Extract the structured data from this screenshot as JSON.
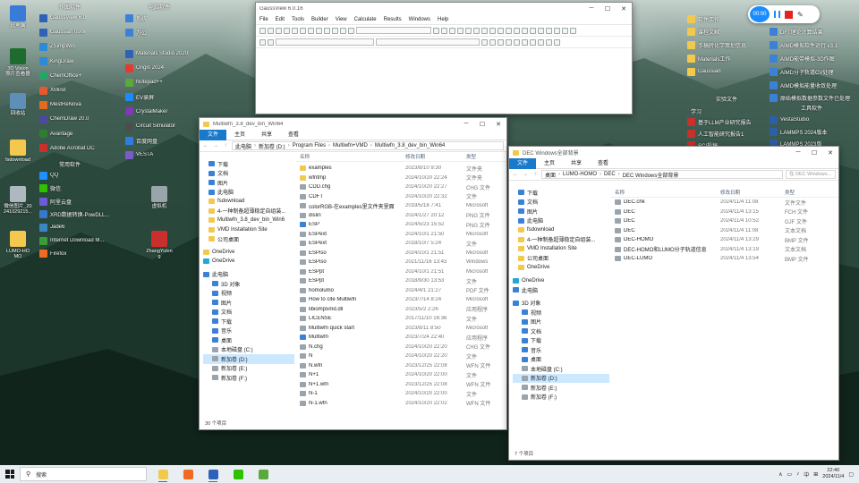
{
  "desktop": {
    "left_icons": [
      {
        "label": "此电脑",
        "color": "#3b7bd8"
      },
      {
        "label": "3D Vision\n照片查看器",
        "color": "#1d6b2e"
      },
      {
        "label": "回收站",
        "color": "#5f8fb7"
      },
      {
        "label": "fsdownload",
        "color": "#f3c94d"
      },
      {
        "label": "微信图片_20\n241029215...",
        "color": "#b0b8bf"
      },
      {
        "label": "LUMO-HO\nMO",
        "color": "#f3c94d"
      }
    ],
    "col2_header": "作图软件",
    "col2": [
      {
        "label": "GaussView 6.0",
        "color": "#2d62b8"
      },
      {
        "label": "Gaussian 09W",
        "color": "#2d62b8"
      },
      {
        "label": "ZSimpWin",
        "color": "#2a8bd6"
      },
      {
        "label": "KingDraw",
        "color": "#2a8bd6"
      },
      {
        "label": "ChemOffice+",
        "color": "#2aa36b"
      },
      {
        "label": "XMind",
        "color": "#e25a2e"
      },
      {
        "label": "MestReNova",
        "color": "#e66a22"
      },
      {
        "label": "ChemDraw 20.0",
        "color": "#4b4b9e"
      },
      {
        "label": "Avantage",
        "color": "#2f7d32"
      },
      {
        "label": "Adobe Acrobat DC",
        "color": "#c9302c"
      }
    ],
    "col2_header2": "常用软件",
    "col2b": [
      {
        "label": "QQ",
        "color": "#1e90ff"
      },
      {
        "label": "微信",
        "color": "#2dc100"
      },
      {
        "label": "阿里云盘",
        "color": "#6b5bd6"
      },
      {
        "label": "XRD数据转换-PowDLL...",
        "color": "#3778c9"
      },
      {
        "label": "Jade6",
        "color": "#3a87c5"
      },
      {
        "label": "Internet Download M...",
        "color": "#3a9d3a"
      },
      {
        "label": "Firefox",
        "color": "#f06b21"
      }
    ],
    "col3_header": "电脑软件",
    "col3": [
      {
        "label": "Materials Studio 2020",
        "color": "#2d62b8"
      },
      {
        "label": "Origin 2024",
        "color": "#e63a2e"
      },
      {
        "label": "Notepad++",
        "color": "#5aa93b"
      },
      {
        "label": "EV录屏",
        "color": "#1a8cff"
      },
      {
        "label": "CrystalMaker",
        "color": "#7e3bb5"
      },
      {
        "label": "Circuit Simulator",
        "color": "#4d4d4d"
      },
      {
        "label": "百度网盘",
        "color": "#2f7de1"
      },
      {
        "label": "VESTA",
        "color": "#7a5cc8"
      }
    ],
    "col3_extra": [
      {
        "label": "系统",
        "color": "#3b82d6"
      },
      {
        "label": "办公",
        "color": "#3b82d6"
      },
      {
        "label": "测绘软件",
        "color": "#3b82d6"
      },
      {
        "label": "设计",
        "color": "#3b82d6"
      },
      {
        "label": "文档",
        "color": "#3b82d6"
      },
      {
        "label": "磁盘",
        "color": "#3b82d6"
      },
      {
        "label": "软件",
        "color": "#3b82d6"
      },
      {
        "label": "个人收藏",
        "color": "#3b82d6"
      }
    ],
    "mid_icons": [
      {
        "label": "ZhangYulon\ng",
        "color": "#c9302c"
      },
      {
        "label": "虚拟机",
        "color": "#9aa4ad"
      }
    ],
    "right_header": "实验文件",
    "right_col_a": [
      {
        "label": "软件工作",
        "color": "#f3c94d"
      },
      {
        "label": "课程文献",
        "color": "#f3c94d"
      },
      {
        "label": "手稿转化学策划信息",
        "color": "#f3c94d"
      },
      {
        "label": "Materials工作",
        "color": "#f3c94d"
      },
      {
        "label": "Gaussian",
        "color": "#f3c94d"
      }
    ],
    "right_col_b": [
      {
        "label": "数据版本3.3",
        "color": "#3b82d6"
      },
      {
        "label": "DFT理论计算结果",
        "color": "#3b82d6"
      },
      {
        "label": "AIMD模拟软件运行 v3.1",
        "color": "#3b82d6"
      },
      {
        "label": "AIMD能带模拟-3D作图",
        "color": "#3b82d6"
      },
      {
        "label": "AIMD分子轨道CV处理",
        "color": "#3b82d6"
      },
      {
        "label": "AIMD模拟能量收敛处理",
        "color": "#3b82d6"
      },
      {
        "label": "原始模拟数据参数文件已处理",
        "color": "#3b82d6"
      }
    ],
    "right_header2": "学习",
    "right_col_c": [
      {
        "label": "基于LLM产业研究报告...",
        "color": "#c9302c"
      },
      {
        "label": "人工智能研究报告1",
        "color": "#c9302c"
      },
      {
        "label": "SCI投稿",
        "color": "#c9302c"
      },
      {
        "label": "文献",
        "color": "#c9302c"
      },
      {
        "label": "实验",
        "color": "#c9302c"
      }
    ],
    "right_header3": "工具软件",
    "right_col_d": [
      {
        "label": "VestaStudio",
        "color": "#2b5fa8"
      },
      {
        "label": "LAMMPS 2024版本",
        "color": "#2b5fa8"
      },
      {
        "label": "LAMMPS 2023版",
        "color": "#2b5fa8"
      },
      {
        "label": "LAMMPS 2022",
        "color": "#2b5fa8"
      },
      {
        "label": "LAMMPS",
        "color": "#2b5fa8"
      }
    ]
  },
  "gaussview": {
    "title": "GaussView 6.0.16",
    "menu": [
      "File",
      "Edit",
      "Tools",
      "Builder",
      "View",
      "Calculate",
      "Results",
      "Windows",
      "Help"
    ]
  },
  "explorer1": {
    "title": "Multiwfn_3.8_dev_bin_Win64",
    "tabs": [
      "文件",
      "主页",
      "共享",
      "查看"
    ],
    "path": [
      "此电脑",
      "新加卷 (D:)",
      "Program Files",
      "Multiwfn+VMD",
      "Multiwfn_3.8_dev_bin_Win64"
    ],
    "nav": [
      {
        "label": "下载",
        "icon": "blue"
      },
      {
        "label": "文档",
        "icon": "blue"
      },
      {
        "label": "图片",
        "icon": "blue"
      },
      {
        "label": "此电脑",
        "icon": "blue"
      },
      {
        "label": "fsdownload",
        "icon": "folder"
      },
      {
        "label": "4-一种制备超薄稳定自组装...",
        "icon": "folder"
      },
      {
        "label": "Multiwfn_3.8_dev_bin_Win6",
        "icon": "folder"
      },
      {
        "label": "VMD Installation Site",
        "icon": "folder"
      },
      {
        "label": "公司桌面",
        "icon": "folder"
      },
      {
        "label": "OneDrive",
        "icon": "folder"
      },
      {
        "label": "OneDrive",
        "icon": "cyan"
      },
      {
        "label": "此电脑",
        "icon": "blue"
      },
      {
        "label": "3D 对象",
        "icon": "blue"
      },
      {
        "label": "视频",
        "icon": "blue"
      },
      {
        "label": "图片",
        "icon": "blue"
      },
      {
        "label": "文档",
        "icon": "blue"
      },
      {
        "label": "下载",
        "icon": "blue"
      },
      {
        "label": "音乐",
        "icon": "blue"
      },
      {
        "label": "桌面",
        "icon": "blue"
      },
      {
        "label": "本地磁盘 (C:)",
        "icon": "gray"
      },
      {
        "label": "新加卷 (D:)",
        "icon": "gray"
      },
      {
        "label": "新加卷 (E:)",
        "icon": "gray"
      },
      {
        "label": "新加卷 (F:)",
        "icon": "gray"
      }
    ],
    "columns": [
      "名称",
      "修改日期",
      "类型"
    ],
    "files": [
      {
        "name": "examples",
        "date": "2023/8/10 9:30",
        "type": "文件夹",
        "icon": "folder"
      },
      {
        "name": "wfntmp",
        "date": "2024/10/20 22:24",
        "type": "文件夹",
        "icon": "folder"
      },
      {
        "name": "CDD.chg",
        "date": "2024/10/20 22:27",
        "type": "CHG 文件",
        "icon": "gray"
      },
      {
        "name": "CDFT",
        "date": "2024/10/20 22:32",
        "type": "文件",
        "icon": "gray"
      },
      {
        "name": "colorRGB-在examples里文件夹里面",
        "date": "2019/5/18 7:41",
        "type": "Microsoft",
        "icon": "gray"
      },
      {
        "name": "dislin",
        "date": "2024/1/27 20:12",
        "type": "PNG 文件",
        "icon": "gray"
      },
      {
        "name": "ESP",
        "date": "2024/5/23 15:52",
        "type": "PNG 文件",
        "icon": "blue"
      },
      {
        "name": "ESPext",
        "date": "2024/10/1 21:50",
        "type": "Microsoft",
        "icon": "gray"
      },
      {
        "name": "ESPext",
        "date": "2018/10/7 5:24",
        "type": "文件",
        "icon": "gray"
      },
      {
        "name": "ESPiso",
        "date": "2024/10/1 21:51",
        "type": "Microsoft",
        "icon": "gray"
      },
      {
        "name": "ESPiso",
        "date": "2021/11/16 13:43",
        "type": "Windows",
        "icon": "gray"
      },
      {
        "name": "ESPpt",
        "date": "2024/10/1 21:51",
        "type": "Microsoft",
        "icon": "gray"
      },
      {
        "name": "ESPpt",
        "date": "2018/9/30 13:53",
        "type": "文件",
        "icon": "gray"
      },
      {
        "name": "homolumo",
        "date": "2024/4/1 21:27",
        "type": "PDF 文件",
        "icon": "gray"
      },
      {
        "name": "How to cite Multiwfn",
        "date": "2023/7/14 8:24",
        "type": "Microsoft",
        "icon": "gray"
      },
      {
        "name": "libiomp5md.dll",
        "date": "2023/5/2 2:26",
        "type": "应用程序",
        "icon": "gray"
      },
      {
        "name": "LICENSE",
        "date": "2017/11/10 16:36",
        "type": "文件",
        "icon": "gray"
      },
      {
        "name": "Multiwfn quick start",
        "date": "2023/8/11 8:50",
        "type": "Microsoft",
        "icon": "gray"
      },
      {
        "name": "Multiwfn",
        "date": "2023/7/24 22:40",
        "type": "应用程序",
        "icon": "blue"
      },
      {
        "name": "N.chg",
        "date": "2024/10/20 22:20",
        "type": "CHG 文件",
        "icon": "gray"
      },
      {
        "name": "N",
        "date": "2024/10/20 22:20",
        "type": "文件",
        "icon": "gray"
      },
      {
        "name": "N.wfn",
        "date": "2023/12/25 22:08",
        "type": "WFN 文件",
        "icon": "gray"
      },
      {
        "name": "N+1",
        "date": "2024/10/20 22:00",
        "type": "文件",
        "icon": "gray"
      },
      {
        "name": "N+1.wfn",
        "date": "2023/12/25 22:08",
        "type": "WFN 文件",
        "icon": "gray"
      },
      {
        "name": "N-1",
        "date": "2024/10/20 22:00",
        "type": "文件",
        "icon": "gray"
      },
      {
        "name": "N-1.wfn",
        "date": "2024/10/20 22:02",
        "type": "WFN 文件",
        "icon": "gray"
      }
    ],
    "status": "30 个项目"
  },
  "explorer2": {
    "title": "DEC Windows全部背景",
    "tabs": [
      "文件",
      "主页",
      "共享",
      "查看"
    ],
    "path": [
      "桌面",
      "LUMO-HOMO",
      "DEC",
      "DEC Windows全部背景"
    ],
    "search_placeholder": "在 DEC Windows...",
    "nav": [
      {
        "label": "下载",
        "icon": "blue"
      },
      {
        "label": "文档",
        "icon": "blue"
      },
      {
        "label": "图片",
        "icon": "blue"
      },
      {
        "label": "此电脑",
        "icon": "blue"
      },
      {
        "label": "fsdownload",
        "icon": "folder"
      },
      {
        "label": "4-一种制备超薄稳定自组装...",
        "icon": "folder"
      },
      {
        "label": "VMD Installation Site",
        "icon": "folder"
      },
      {
        "label": "公司桌面",
        "icon": "folder"
      },
      {
        "label": "OneDrive",
        "icon": "folder"
      },
      {
        "label": "OneDrive",
        "icon": "cyan"
      },
      {
        "label": "此电脑",
        "icon": "blue"
      },
      {
        "label": "3D 对象",
        "icon": "blue"
      },
      {
        "label": "视频",
        "icon": "blue"
      },
      {
        "label": "图片",
        "icon": "blue"
      },
      {
        "label": "文档",
        "icon": "blue"
      },
      {
        "label": "下载",
        "icon": "blue"
      },
      {
        "label": "音乐",
        "icon": "blue"
      },
      {
        "label": "桌面",
        "icon": "blue"
      },
      {
        "label": "本地磁盘 (C:)",
        "icon": "gray"
      },
      {
        "label": "新加卷 (D:)",
        "icon": "gray"
      },
      {
        "label": "新加卷 (E:)",
        "icon": "gray"
      },
      {
        "label": "新加卷 (F:)",
        "icon": "gray"
      }
    ],
    "columns": [
      "名称",
      "修改日期",
      "类型"
    ],
    "files": [
      {
        "name": "DEC.chk",
        "date": "2024/11/4 11:08",
        "type": "文件文件",
        "icon": "gray"
      },
      {
        "name": "DEC",
        "date": "2024/11/4 13:15",
        "type": "FCH 文件",
        "icon": "gray"
      },
      {
        "name": "DEC",
        "date": "2024/11/4 10:52",
        "type": "GJF 文件",
        "icon": "gray"
      },
      {
        "name": "DEC",
        "date": "2024/11/4 11:08",
        "type": "文本文档",
        "icon": "gray"
      },
      {
        "name": "DEC-HOMO",
        "date": "2024/11/4 13:29",
        "type": "BMP 文件",
        "icon": "gray"
      },
      {
        "name": "DEC-HOMO和LUMO分子轨道信息",
        "date": "2024/11/4 13:19",
        "type": "文本文档",
        "icon": "gray"
      },
      {
        "name": "DEC-LUMO",
        "date": "2024/11/4 13:54",
        "type": "BMP 文件",
        "icon": "gray"
      }
    ],
    "status": "7 个项目"
  },
  "recorder": {
    "time": "00:00"
  },
  "taskbar": {
    "search_placeholder": "搜索",
    "apps": [
      {
        "name": "file-explorer",
        "color": "#f3c94d",
        "active": true
      },
      {
        "name": "firefox",
        "color": "#f06b21",
        "active": false
      },
      {
        "name": "gaussview",
        "color": "#2d62b8",
        "active": true
      },
      {
        "name": "wechat",
        "color": "#2dc100",
        "active": false
      },
      {
        "name": "notepad",
        "color": "#5aa93b",
        "active": false
      }
    ],
    "tray_lang": "中",
    "time": "22:40",
    "date": "2024/11/4"
  }
}
